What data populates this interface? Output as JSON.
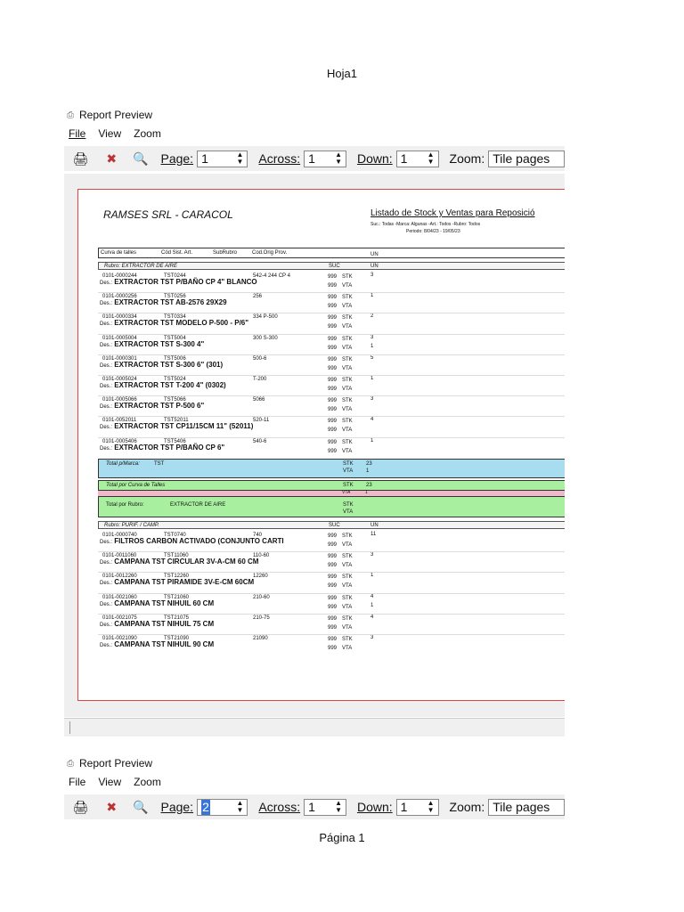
{
  "sheet_title": "Hoja1",
  "page_footer": "Página 1",
  "window1": {
    "title": "Report Preview",
    "menu": [
      "File",
      "View",
      "Zoom"
    ],
    "toolbar": {
      "page_label": "Page:",
      "page_value": "1",
      "across_label": "Across:",
      "across_value": "1",
      "down_label": "Down:",
      "down_value": "1",
      "zoom_label": "Zoom:",
      "zoom_value": "Tile pages"
    }
  },
  "window2": {
    "title": "Report Preview",
    "menu": [
      "File",
      "View",
      "Zoom"
    ],
    "toolbar": {
      "page_label": "Page:",
      "page_value": "2",
      "across_label": "Across:",
      "across_value": "1",
      "down_label": "Down:",
      "down_value": "1",
      "zoom_label": "Zoom:",
      "zoom_value": "Tile pages"
    }
  },
  "report": {
    "company": "RAMSES SRL - CARACOL",
    "title": "Listado de Stock y Ventas para Reposició",
    "filters": "Suc.: Todas -Marca: Algunas -Art.: Todos -Rubro: Todos",
    "period": "Periodo: 8/04/23 - 19/05/23",
    "header_cols": [
      "Curva de talles",
      "Cód Sist. Art.",
      "SubRubro",
      "Cod.Orig Prov."
    ],
    "header_un": "UN",
    "rubro1": {
      "label": "Rubro:  EXTRACTOR DE AIRE",
      "suc": "SUC",
      "un": "UN"
    },
    "items1": [
      {
        "code": "0101-0000244",
        "art": "TST0244",
        "orig": "542-4 244  CP 4",
        "desc": "EXTRACTOR TST P/BAÑO CP 4\" BLANCO",
        "suc": "999",
        "stk": "3",
        "vta": ""
      },
      {
        "code": "0101-0000256",
        "art": "TST0256",
        "orig": "256",
        "desc": "EXTRACTOR TST AB-2576 29X29",
        "suc": "999",
        "stk": "1",
        "vta": ""
      },
      {
        "code": "0101-0000334",
        "art": "TST0334",
        "orig": "334  P-500",
        "desc": "EXTRACTOR TST MODELO P-500 - P/6\"",
        "suc": "999",
        "stk": "2",
        "vta": ""
      },
      {
        "code": "0101-0005004",
        "art": "TST5004",
        "orig": "300  S-300",
        "desc": "EXTRACTOR TST S-300 4\"",
        "suc": "999",
        "stk": "3",
        "vta": "1"
      },
      {
        "code": "0101-0000301",
        "art": "TST5006",
        "orig": "500-6",
        "desc": "EXTRACTOR TST S-300 6\" (301)",
        "suc": "999",
        "stk": "5",
        "vta": ""
      },
      {
        "code": "0101-0005024",
        "art": "TST5024",
        "orig": "T-200",
        "desc": "EXTRACTOR TST T-200  4\" (0302)",
        "suc": "999",
        "stk": "1",
        "vta": ""
      },
      {
        "code": "0101-0005066",
        "art": "TST5066",
        "orig": "5066",
        "desc": "EXTRACTOR TST P-500 6\"",
        "suc": "999",
        "stk": "3",
        "vta": ""
      },
      {
        "code": "0101-0052011",
        "art": "TST52011",
        "orig": "520-11",
        "desc": "EXTRACTOR TST CP11/15CM 11\" (52011)",
        "suc": "999",
        "stk": "4",
        "vta": ""
      },
      {
        "code": "0101-0005406",
        "art": "TST5406",
        "orig": "540-6",
        "desc": "EXTRACTOR TST P/BAÑO CP 6\"",
        "suc": "999",
        "stk": "1",
        "vta": ""
      }
    ],
    "stk_label": "STK",
    "vta_label": "VTA",
    "desc_label": "Des.:",
    "total_marca": {
      "label": "Total p/Marca:",
      "value": "TST",
      "stk": "23",
      "vta": "1"
    },
    "total_curva": {
      "label": "Total por Curva de Talles",
      "stk": "23",
      "vta": "1"
    },
    "total_rubro": {
      "label": "Total por Rubro:",
      "value": "EXTRACTOR DE AIRE"
    },
    "rubro2": {
      "label": "Rubro:  PURIF. / CAMP.",
      "suc": "SUC",
      "un": "UN"
    },
    "items2": [
      {
        "code": "0101-0000740",
        "art": "TST0740",
        "orig": "740",
        "desc": "FILTROS CARBON ACTIVADO (CONJUNTO CARTI",
        "suc": "999",
        "stk": "11",
        "vta": ""
      },
      {
        "code": "0101-0011060",
        "art": "TST11060",
        "orig": "110-60",
        "desc": "CAMPANA TST CIRCULAR 3V-A-CM 60 CM",
        "suc": "999",
        "stk": "3",
        "vta": ""
      },
      {
        "code": "0101-0012260",
        "art": "TST12260",
        "orig": "12260",
        "desc": "CAMPANA TST PIRAMIDE 3V-E-CM 60CM",
        "suc": "999",
        "stk": "1",
        "vta": ""
      },
      {
        "code": "0101-0021060",
        "art": "TST21060",
        "orig": "210-60",
        "desc": "CAMPANA TST NIHUIL 60 CM",
        "suc": "999",
        "stk": "4",
        "vta": "1"
      },
      {
        "code": "0101-0021075",
        "art": "TST21075",
        "orig": "210-75",
        "desc": "CAMPANA TST NIHUIL 75 CM",
        "suc": "999",
        "stk": "4",
        "vta": ""
      },
      {
        "code": "0101-0021090",
        "art": "TST21090",
        "orig": "21090",
        "desc": "CAMPANA TST NIHUIL 90 CM",
        "suc": "999",
        "stk": "3",
        "vta": ""
      }
    ]
  }
}
